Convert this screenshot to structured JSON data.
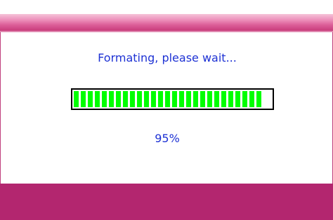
{
  "dialog": {
    "message": "Formating, please wait...",
    "progress_label": "95%",
    "progress_fraction": 0.95
  },
  "colors": {
    "titlebar_accent": "#dc5e98",
    "footer": "#b3266f",
    "text": "#1e32d4",
    "progress_fill": "#00ff00"
  }
}
